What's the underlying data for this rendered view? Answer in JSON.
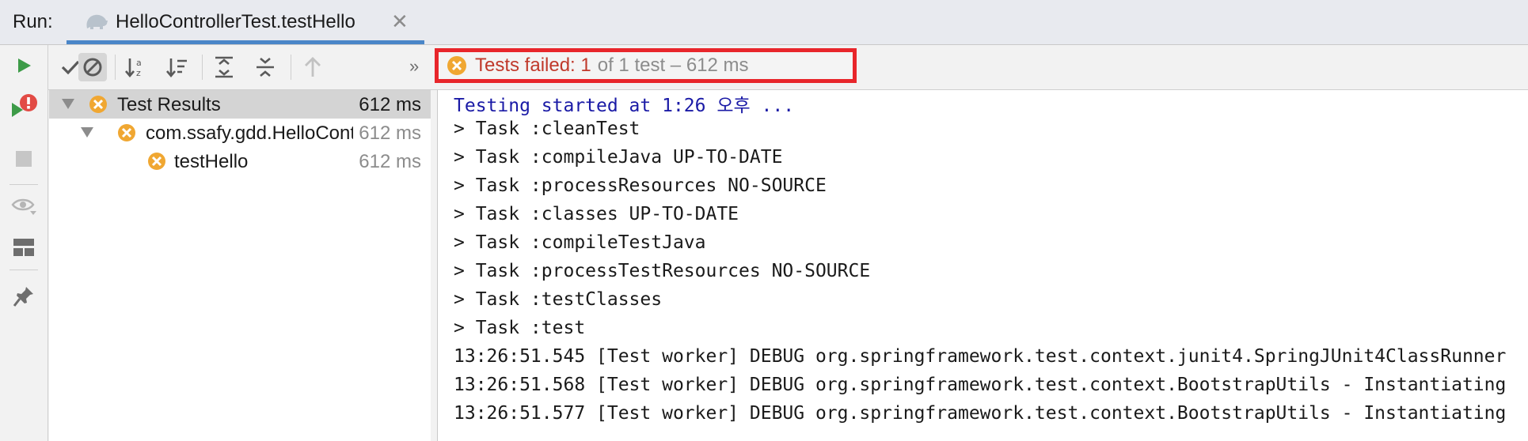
{
  "tabbar": {
    "run_label": "Run:",
    "tab_title": "HelloControllerTest.testHello",
    "close_glyph": "✕",
    "accent": "#4a86c8"
  },
  "toolbar": {
    "more_glyph": "»",
    "status_failed": "Tests failed: 1",
    "status_rest": "of 1 test – 612 ms",
    "highlight_color": "#e8262b"
  },
  "tree": {
    "rows": [
      {
        "label": "Test Results",
        "time": "612 ms"
      },
      {
        "label": "com.ssafy.gdd.HelloControllerTest",
        "time": "612 ms"
      },
      {
        "label": "testHello",
        "time": "612 ms"
      }
    ]
  },
  "console": {
    "lines": [
      "Testing started at 1:26 오후 ...",
      "> Task :cleanTest",
      "> Task :compileJava UP-TO-DATE",
      "> Task :processResources NO-SOURCE",
      "> Task :classes UP-TO-DATE",
      "> Task :compileTestJava",
      "> Task :processTestResources NO-SOURCE",
      "> Task :testClasses",
      "> Task :test",
      "13:26:51.545 [Test worker] DEBUG org.springframework.test.context.junit4.SpringJUnit4ClassRunner",
      "13:26:51.568 [Test worker] DEBUG org.springframework.test.context.BootstrapUtils - Instantiating",
      "13:26:51.577 [Test worker] DEBUG org.springframework.test.context.BootstrapUtils - Instantiating"
    ]
  },
  "colors": {
    "fail_orange": "#f0a732",
    "run_green": "#3d9b48",
    "rerun_red": "#e24b45"
  }
}
